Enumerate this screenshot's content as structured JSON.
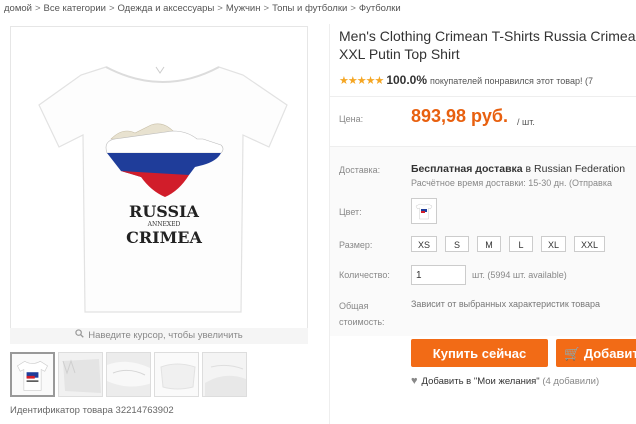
{
  "breadcrumb": {
    "items": [
      "домой",
      "Все категории",
      "Одежда и аксессуары",
      "Мужчин",
      "Топы и футболки",
      "Футболки"
    ],
    "separator": ">"
  },
  "gallery": {
    "zoom_hint": "Наведите курсор, чтобы увеличить",
    "product_id": "Идентификатор товара 32214763902",
    "shirt_text": {
      "line1": "RUSSIA",
      "line2": "ANNEXED",
      "line3": "CRIMEA"
    },
    "thumbnails": 5
  },
  "product": {
    "title_line1": "Men's Clothing Crimean T-Shirts Russia Crimea",
    "title_line2": "XXL Putin Top Shirt",
    "stars": "★★★★★",
    "rating": "100.0%",
    "rating_text": "покупателей понравился этот товар! (7",
    "price_label": "Цена:",
    "price": "893,98 руб.",
    "price_unit": "/ шт.",
    "shipping_label": "Доставка:",
    "shipping_free": "Бесплатная доставка",
    "shipping_to": "в Russian Federation",
    "shipping_time": "Расчётное время доставки: 15-30 дн. (Отправка",
    "color_label": "Цвет:",
    "size_label": "Размер:",
    "sizes": [
      "XS",
      "S",
      "M",
      "L",
      "XL",
      "XXL"
    ],
    "qty_label": "Количество:",
    "qty_value": "1",
    "qty_note": "шт. (5994 шт. available)",
    "total_label_line1": "Общая",
    "total_label_line2": "стоимость:",
    "total_note": "Зависит от выбранных характеристик товара",
    "buy_button": "Купить сейчас",
    "cart_button": "Добавить в корзину",
    "wishlist": "Добавить в \"Мои желания\"",
    "wishlist_count": "(4 добавили)"
  },
  "colors": {
    "accent": "#f26b16",
    "price": "#e8600f",
    "stars": "#f5a623"
  }
}
